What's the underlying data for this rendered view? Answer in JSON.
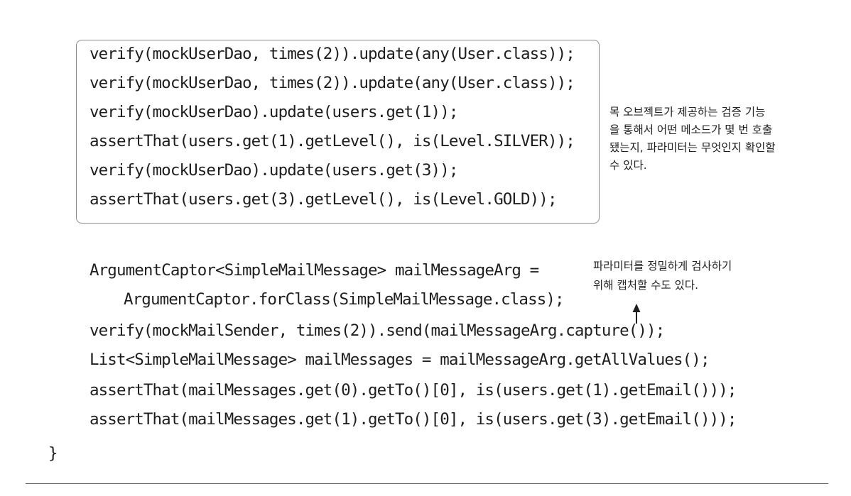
{
  "verify_block": {
    "lines": [
      "verify(mockUserDao, times(2)).update(any(User.class));",
      "verify(mockUserDao, times(2)).update(any(User.class));",
      "verify(mockUserDao).update(users.get(1));",
      "assertThat(users.get(1).getLevel(), is(Level.SILVER));",
      "verify(mockUserDao).update(users.get(3));",
      "assertThat(users.get(3).getLevel(), is(Level.GOLD));"
    ]
  },
  "captor_block": {
    "lines": [
      "ArgumentCaptor<SimpleMailMessage> mailMessageArg =",
      "ArgumentCaptor.forClass(SimpleMailMessage.class);",
      "verify(mockMailSender, times(2)).send(mailMessageArg.capture());",
      "List<SimpleMailMessage> mailMessages = mailMessageArg.getAllValues();",
      "assertThat(mailMessages.get(0).getTo()[0], is(users.get(1).getEmail()));",
      "assertThat(mailMessages.get(1).getTo()[0], is(users.get(3).getEmail()));"
    ]
  },
  "closing_brace": "}",
  "annotations": {
    "verify_note": [
      "목 오브젝트가 제공하는 검증 기능",
      "을 통해서 어떤 메소드가 몇 번 호출",
      "됐는지, 파라미터는 무엇인지 확인할",
      "수 있다."
    ],
    "captor_note": [
      "파라미터를 정밀하게 검사하기",
      "위해 캡처할 수도 있다."
    ]
  }
}
